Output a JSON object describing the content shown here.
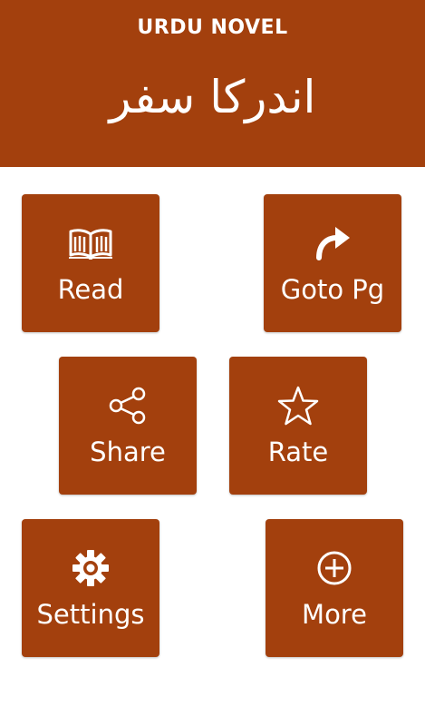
{
  "header": {
    "app_title": "URDU NOVEL",
    "novel_title": "اندرکا سفر",
    "background_color": "#a3400d"
  },
  "menu": {
    "read": {
      "label": "Read",
      "icon": "book-icon"
    },
    "goto": {
      "label": "Goto Pg",
      "icon": "forward-arrow-icon"
    },
    "share": {
      "label": "Share",
      "icon": "share-icon"
    },
    "rate": {
      "label": "Rate",
      "icon": "star-icon"
    },
    "settings": {
      "label": "Settings",
      "icon": "gear-icon"
    },
    "more": {
      "label": "More",
      "icon": "plus-circle-icon"
    }
  },
  "colors": {
    "tile": "#a3400d",
    "text": "#ffffff"
  }
}
